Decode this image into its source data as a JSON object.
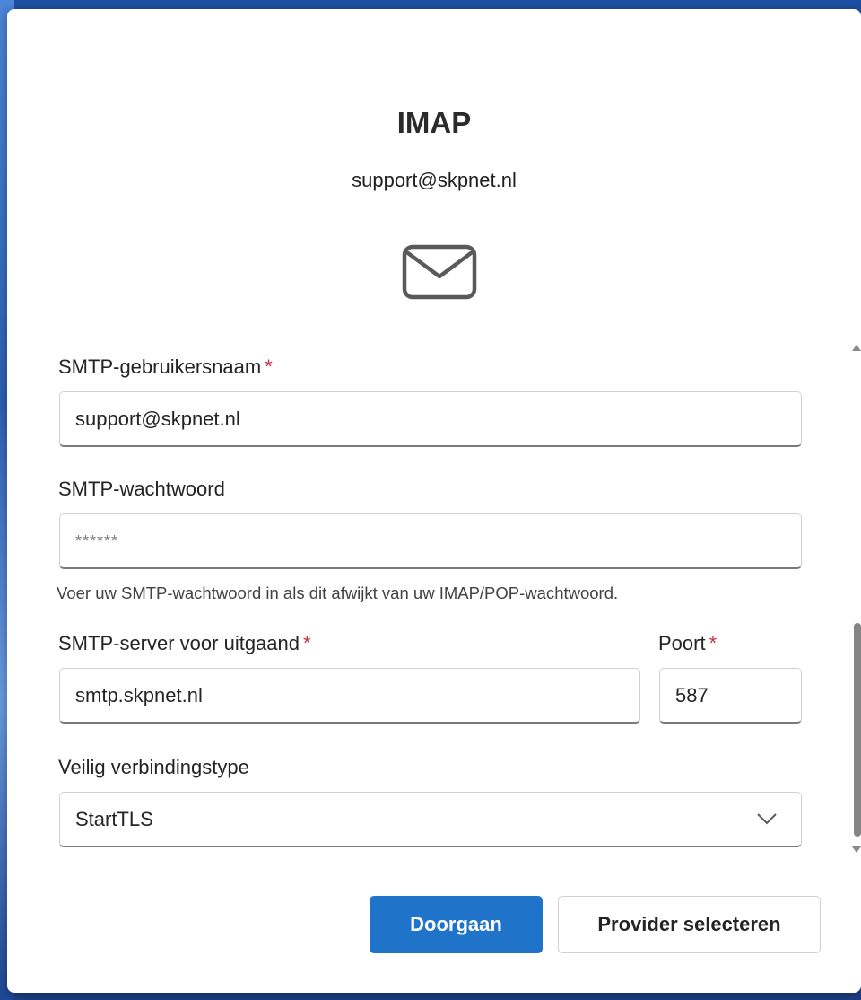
{
  "dialog": {
    "title": "IMAP",
    "email": "support@skpnet.nl",
    "icon": "mail-icon"
  },
  "form": {
    "username": {
      "label": "SMTP-gebruikersnaam",
      "required_mark": "*",
      "value": "support@skpnet.nl"
    },
    "password": {
      "label": "SMTP-wachtwoord",
      "value": "******",
      "hint": "Voer uw SMTP-wachtwoord in als dit afwijkt van uw IMAP/POP-wachtwoord."
    },
    "server": {
      "label": "SMTP-server voor uitgaand",
      "required_mark": "*",
      "value": "smtp.skpnet.nl"
    },
    "port": {
      "label": "Poort",
      "required_mark": "*",
      "value": "587"
    },
    "security": {
      "label": "Veilig verbindingstype",
      "selected": "StartTLS",
      "icon": "chevron-down-icon"
    }
  },
  "buttons": {
    "continue_label": "Doorgaan",
    "select_provider_label": "Provider selecteren"
  },
  "colors": {
    "primary": "#1f74c9",
    "required": "#c4314b",
    "text": "#242424"
  }
}
